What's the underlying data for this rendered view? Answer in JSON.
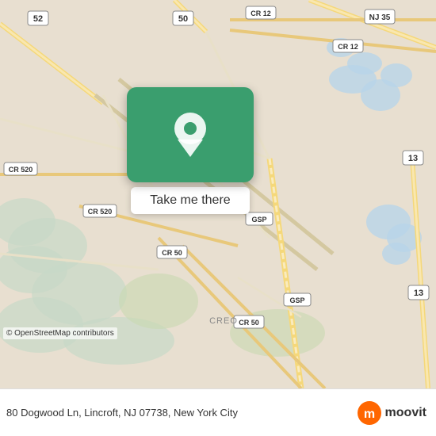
{
  "map": {
    "alt": "Map of Lincroft, NJ area",
    "background_color": "#e8e0d8"
  },
  "popup": {
    "take_me_there_label": "Take me there",
    "green_color": "#3a9e6e"
  },
  "bottom_bar": {
    "address": "80 Dogwood Ln, Lincroft, NJ 07738, New York City",
    "copyright": "© OpenStreetMap contributors",
    "moovit_label": "moovit"
  },
  "route_labels": {
    "r52": "52",
    "r50": "50",
    "cr12a": "CR 12",
    "cr12b": "CR 12",
    "nj35": "NJ 35",
    "cr520a": "CR 520",
    "cr520b": "CR 520",
    "cr50a": "CR 50",
    "cr50b": "CR 50",
    "gsp_a": "GSP",
    "gsp_b": "GSP",
    "r13a": "13",
    "r13b": "13",
    "creo": "CREO"
  }
}
